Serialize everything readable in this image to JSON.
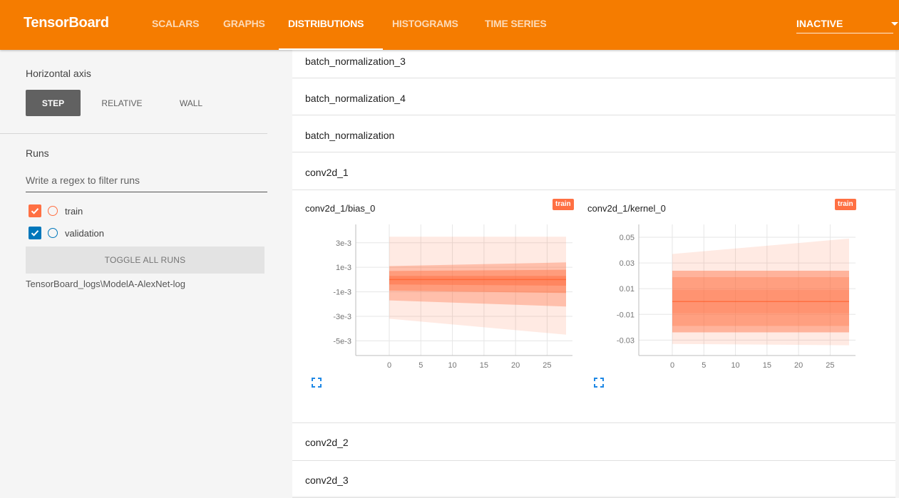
{
  "app": {
    "title": "TensorBoard"
  },
  "nav": {
    "tabs": [
      {
        "label": "SCALARS",
        "active": false
      },
      {
        "label": "GRAPHS",
        "active": false
      },
      {
        "label": "DISTRIBUTIONS",
        "active": true
      },
      {
        "label": "HISTOGRAMS",
        "active": false
      },
      {
        "label": "TIME SERIES",
        "active": false
      }
    ],
    "inactive_label": "INACTIVE"
  },
  "sidebar": {
    "horizontal_axis_label": "Horizontal axis",
    "axis_options": [
      {
        "label": "STEP",
        "active": true
      },
      {
        "label": "RELATIVE",
        "active": false
      },
      {
        "label": "WALL",
        "active": false
      }
    ],
    "runs_label": "Runs",
    "filter_placeholder": "Write a regex to filter runs",
    "runs": [
      {
        "name": "train",
        "checked": true,
        "color": "#ff7043"
      },
      {
        "name": "validation",
        "checked": true,
        "color": "#0077bb"
      }
    ],
    "toggle_all_label": "TOGGLE ALL RUNS",
    "logdir": "TensorBoard_logs\\ModelA-AlexNet-log"
  },
  "main": {
    "categories_top": [
      "batch_normalization_3",
      "batch_normalization_4",
      "batch_normalization",
      "conv2d_1"
    ],
    "categories_bottom": [
      "conv2d_2",
      "conv2d_3"
    ]
  },
  "colors": {
    "accent": "#f57c00",
    "run_train": "#ff7043",
    "run_validation": "#0077bb"
  },
  "chart_data": [
    {
      "type": "area",
      "title": "conv2d_1/bias_0",
      "run": "train",
      "x": [
        0,
        28
      ],
      "xticks": [
        0,
        5,
        10,
        15,
        20,
        25
      ],
      "yticks": [
        "3e-3",
        "1e-3",
        "-1e-3",
        "-3e-3",
        "-5e-3"
      ],
      "ytick_values": [
        0.003,
        0.001,
        -0.001,
        -0.003,
        -0.005
      ],
      "ylim": [
        -0.0062,
        0.0045
      ],
      "bands": [
        {
          "lo_start": -0.0032,
          "hi_start": 0.0035,
          "lo_end": -0.0045,
          "hi_end": 0.0035,
          "opacity": 0.15
        },
        {
          "lo_start": -0.0017,
          "hi_start": 0.0011,
          "lo_end": -0.0022,
          "hi_end": 0.0014,
          "opacity": 0.35
        },
        {
          "lo_start": -0.0009,
          "hi_start": 0.0007,
          "lo_end": -0.0011,
          "hi_end": 0.0008,
          "opacity": 0.45
        },
        {
          "lo_start": -0.0004,
          "hi_start": 0.0003,
          "lo_end": -0.0005,
          "hi_end": 0.0003,
          "opacity": 0.5
        }
      ]
    },
    {
      "type": "area",
      "title": "conv2d_1/kernel_0",
      "run": "train",
      "x": [
        0,
        28
      ],
      "xticks": [
        0,
        5,
        10,
        15,
        20,
        25
      ],
      "yticks": [
        "0.05",
        "0.03",
        "0.01",
        "-0.01",
        "-0.03"
      ],
      "ytick_values": [
        0.05,
        0.03,
        0.01,
        -0.01,
        -0.03
      ],
      "ylim": [
        -0.042,
        0.06
      ],
      "bands": [
        {
          "lo_start": -0.033,
          "hi_start": 0.037,
          "lo_end": -0.034,
          "hi_end": 0.049,
          "opacity": 0.15
        },
        {
          "lo_start": -0.024,
          "hi_start": 0.024,
          "lo_end": -0.024,
          "hi_end": 0.024,
          "opacity": 0.45
        },
        {
          "lo_start": -0.019,
          "hi_start": 0.019,
          "lo_end": -0.019,
          "hi_end": 0.019,
          "opacity": 0.3
        },
        {
          "lo_start": -0.009,
          "hi_start": 0.009,
          "lo_end": -0.009,
          "hi_end": 0.009,
          "opacity": 0.25
        }
      ]
    }
  ]
}
